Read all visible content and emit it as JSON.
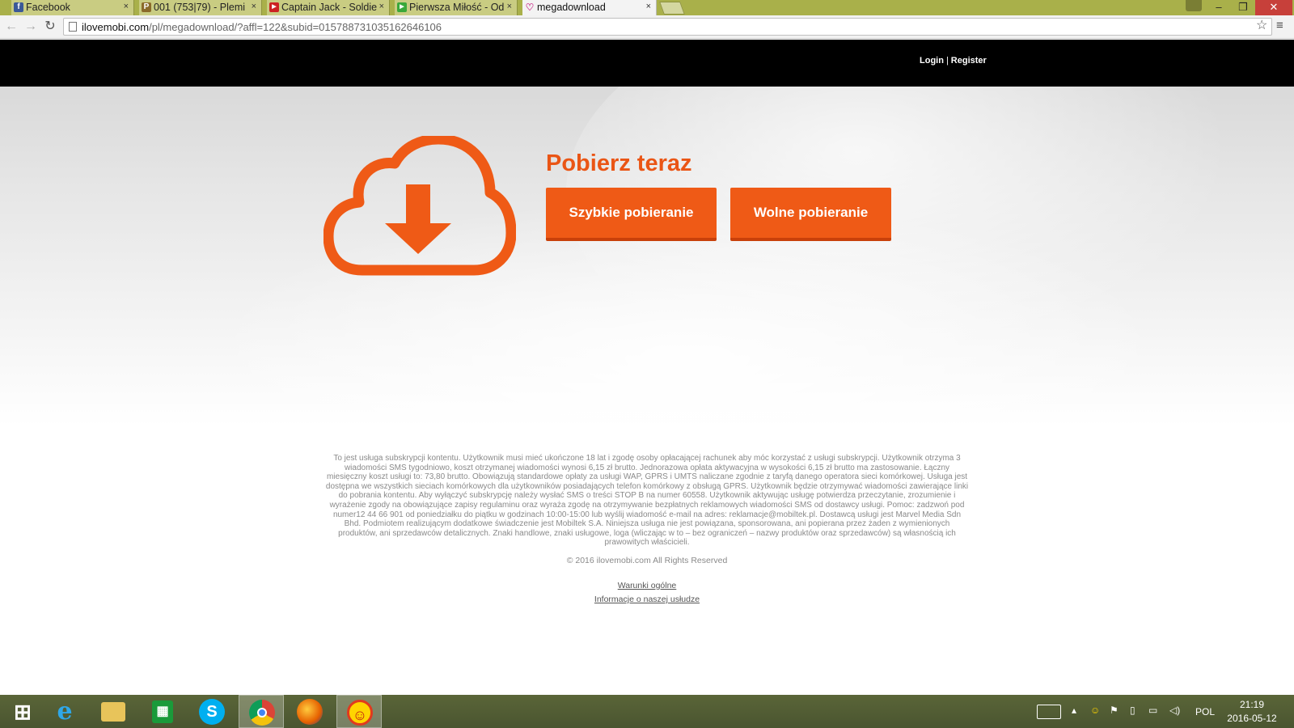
{
  "browser": {
    "tabs": [
      {
        "title": "Facebook",
        "favicon": "facebook-icon",
        "color": "#3b5998",
        "glyph": "f",
        "active": false
      },
      {
        "title": "001 (753|79) - Plemi",
        "favicon": "plemiona-icon",
        "color": "#8a6a2a",
        "glyph": "P",
        "active": false
      },
      {
        "title": "Captain Jack - Soldie",
        "favicon": "youtube-icon",
        "color": "#cc2222",
        "glyph": "▶",
        "active": false
      },
      {
        "title": "Pierwsza Miłość - Od",
        "favicon": "play-icon",
        "color": "#3aa83a",
        "glyph": "▶",
        "active": false
      },
      {
        "title": "megadownload",
        "favicon": "heart-icon",
        "color": "#d04a9a",
        "glyph": "♡",
        "active": true
      }
    ],
    "tab_close": "×",
    "url_host": "ilovemobi.com",
    "url_path": "/pl/megadownload/?affl=122&subid=01578873103516264610​6"
  },
  "header": {
    "login": "Login",
    "separator": "|",
    "register": "Register"
  },
  "hero": {
    "title": "Pobierz teraz",
    "fast_button": "Szybkie pobieranie",
    "slow_button": "Wolne pobieranie",
    "accent": "#ef5a16"
  },
  "footer": {
    "disclaimer": "To jest usługa subskrypcji kontentu. Użytkownik musi mieć ukończone 18 lat i zgodę osoby opłacającej rachunek aby móc korzystać z usługi subskrypcji. Użytkownik otrzyma 3 wiadomości SMS tygodniowo, koszt otrzymanej wiadomości wynosi 6,15 zł brutto. Jednorazowa opłata aktywacyjna w wysokości 6,15 zł brutto ma zastosowanie. Łączny miesięczny koszt usługi to: 73,80 brutto. Obowiązują standardowe opłaty za usługi WAP, GPRS i UMTS naliczane zgodnie z taryfą danego operatora sieci komórkowej. Usługa jest dostępna we wszystkich sieciach komórkowych dla użytkowników posiadających telefon komórkowy z obsługą GPRS. Użytkownik będzie otrzymywać wiadomości zawierające linki do pobrania kontentu. Aby wyłączyć subskrypcję należy wysłać SMS o treści STOP B na numer 60558. Użytkownik aktywując usługę potwierdza przeczytanie, zrozumienie i wyrażenie zgody na obowiązujące zapisy regulaminu oraz wyraża zgodę na otrzymywanie bezpłatnych reklamowych wiadomości SMS od dostawcy usługi. Pomoc: zadzwoń pod numer12 44 66 901 od poniedziałku do piątku w godzinach 10:00-15:00 lub wyślij wiadomość e-mail na adres: reklamacje@mobiltek.pl. Dostawcą usługi jest Marvel Media Sdn Bhd. Podmiotem realizującym dodatkowe świadczenie jest Mobiltek S.A. Niniejsza usługa nie jest powiązana, sponsorowana, ani popierana przez żaden z wymienionych produktów, ani sprzedawców detalicznych. Znaki handlowe, znaki usługowe, loga (wliczając w to – bez ograniczeń – nazwy produktów oraz sprzedawców) są własnością ich prawowitych właścicieli.",
    "copyright": "© 2016 ilovemobi.com All Rights Reserved",
    "terms_link": "Warunki ogólne",
    "info_link": "Informacje o naszej usłudze"
  },
  "taskbar": {
    "apps": [
      {
        "name": "start-icon",
        "glyph": "⊞"
      },
      {
        "name": "internet-explorer-icon",
        "glyph": "e"
      },
      {
        "name": "file-explorer-icon",
        "glyph": "▭"
      },
      {
        "name": "store-icon",
        "glyph": "▣"
      },
      {
        "name": "skype-icon",
        "glyph": "S"
      },
      {
        "name": "chrome-icon",
        "glyph": "◉"
      },
      {
        "name": "firefox-icon",
        "glyph": "●"
      },
      {
        "name": "sun-app-icon",
        "glyph": "☀"
      }
    ],
    "language": "POL",
    "time": "21:19",
    "date": "2016-05-12"
  }
}
